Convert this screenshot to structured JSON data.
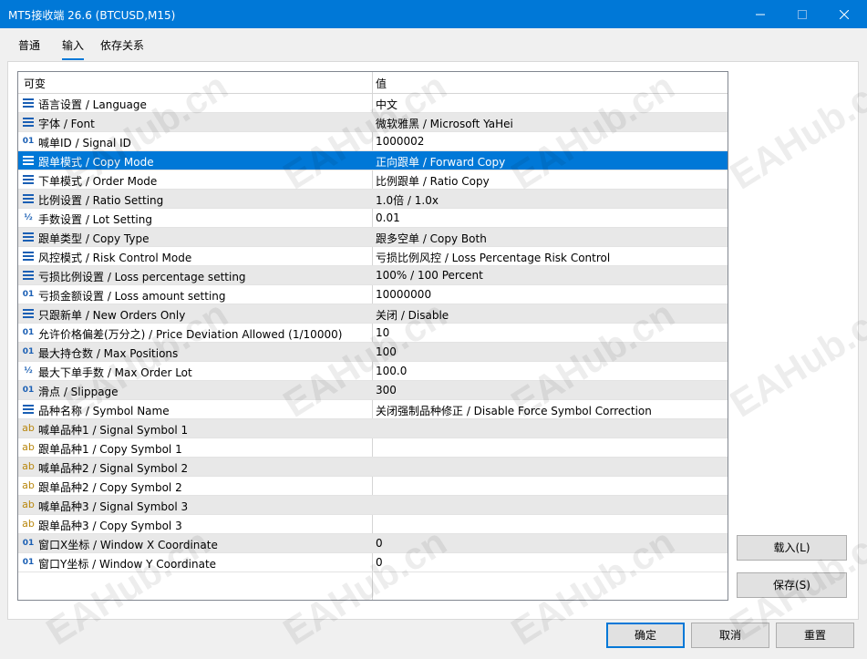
{
  "window": {
    "title": "MT5接收端 26.6 (BTCUSD,M15)"
  },
  "tabs": [
    "普通",
    "输入",
    "依存关系"
  ],
  "grid": {
    "headers": [
      "可变",
      "值"
    ],
    "rows": [
      {
        "icon": "enum",
        "name": "语言设置 / Language",
        "value": "中文"
      },
      {
        "icon": "enum",
        "name": "字体 / Font",
        "value": "微软雅黑 / Microsoft YaHei"
      },
      {
        "icon": "int",
        "name": "喊单ID / Signal ID",
        "value": "1000002"
      },
      {
        "icon": "enum",
        "name": "跟单模式 / Copy Mode",
        "value": "正向跟单 / Forward Copy",
        "selected": true
      },
      {
        "icon": "enum",
        "name": "下单模式 / Order Mode",
        "value": "比例跟单 / Ratio Copy"
      },
      {
        "icon": "enum",
        "name": "比例设置 / Ratio Setting",
        "value": "1.0倍 / 1.0x"
      },
      {
        "icon": "double",
        "name": "手数设置 / Lot Setting",
        "value": "0.01"
      },
      {
        "icon": "enum",
        "name": "跟单类型 / Copy Type",
        "value": "跟多空单 / Copy Both"
      },
      {
        "icon": "enum",
        "name": "风控模式 / Risk Control Mode",
        "value": "亏损比例风控 / Loss Percentage Risk Control"
      },
      {
        "icon": "enum",
        "name": "亏损比例设置 / Loss percentage setting",
        "value": "100% / 100 Percent"
      },
      {
        "icon": "int",
        "name": "亏损金额设置 / Loss amount setting",
        "value": "10000000"
      },
      {
        "icon": "enum",
        "name": "只跟新单 / New Orders Only",
        "value": "关闭 / Disable"
      },
      {
        "icon": "int",
        "name": "允许价格偏差(万分之) / Price Deviation Allowed (1/10000)",
        "value": "10"
      },
      {
        "icon": "int",
        "name": "最大持仓数 / Max Positions",
        "value": "100"
      },
      {
        "icon": "double",
        "name": "最大下单手数 / Max Order Lot",
        "value": "100.0"
      },
      {
        "icon": "int",
        "name": "滑点 / Slippage",
        "value": "300"
      },
      {
        "icon": "enum",
        "name": "品种名称 / Symbol Name",
        "value": "关闭强制品种修正 / Disable Force Symbol Correction"
      },
      {
        "icon": "str",
        "name": "喊单品种1 / Signal Symbol 1",
        "value": ""
      },
      {
        "icon": "str",
        "name": "跟单品种1 / Copy Symbol 1",
        "value": ""
      },
      {
        "icon": "str",
        "name": "喊单品种2 / Signal Symbol 2",
        "value": ""
      },
      {
        "icon": "str",
        "name": "跟单品种2 / Copy Symbol 2",
        "value": ""
      },
      {
        "icon": "str",
        "name": "喊单品种3 / Signal Symbol 3",
        "value": ""
      },
      {
        "icon": "str",
        "name": "跟单品种3 / Copy Symbol 3",
        "value": ""
      },
      {
        "icon": "int",
        "name": "窗口X坐标 / Window X Coordinate",
        "value": "0"
      },
      {
        "icon": "int",
        "name": "窗口Y坐标 / Window Y Coordinate",
        "value": "0"
      }
    ]
  },
  "side_buttons": {
    "load": "载入(L)",
    "save": "保存(S)"
  },
  "footer_buttons": {
    "ok": "确定",
    "cancel": "取消",
    "reset": "重置"
  },
  "watermark": "EAHub.cn",
  "icon_glyphs": {
    "int": "01",
    "double": "½",
    "str": "ab"
  },
  "colors": {
    "titlebar": "#0078d7",
    "selection": "#0078d7"
  }
}
